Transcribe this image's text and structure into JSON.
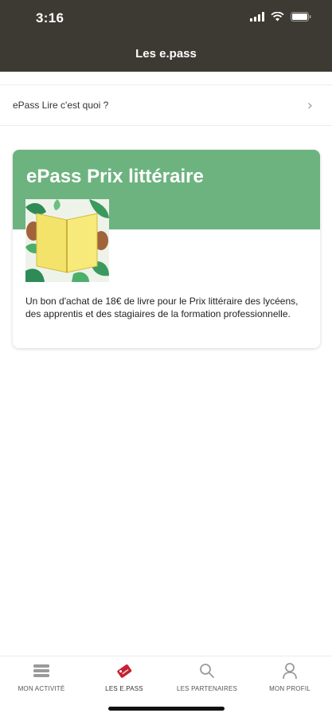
{
  "status_bar": {
    "time": "3:16"
  },
  "header": {
    "title": "Les e.pass"
  },
  "info_row": {
    "label": "ePass Lire c'est quoi ?"
  },
  "card": {
    "title": "ePass Prix littéraire",
    "description": "Un bon d'achat de 18€ de livre pour le Prix littéraire des lycéens, des apprentis et des stagiaires de la formation professionnelle.",
    "header_color": "#6db37f"
  },
  "tabs": [
    {
      "label": "MON ACTIVITÉ",
      "icon": "stack-icon"
    },
    {
      "label": "LES E.PASS",
      "icon": "ticket-icon",
      "active": true
    },
    {
      "label": "LES PARTENAIRES",
      "icon": "search-icon"
    },
    {
      "label": "MON PROFIL",
      "icon": "user-icon"
    }
  ],
  "colors": {
    "top_bar": "#3d3a33",
    "accent": "#c62032"
  }
}
